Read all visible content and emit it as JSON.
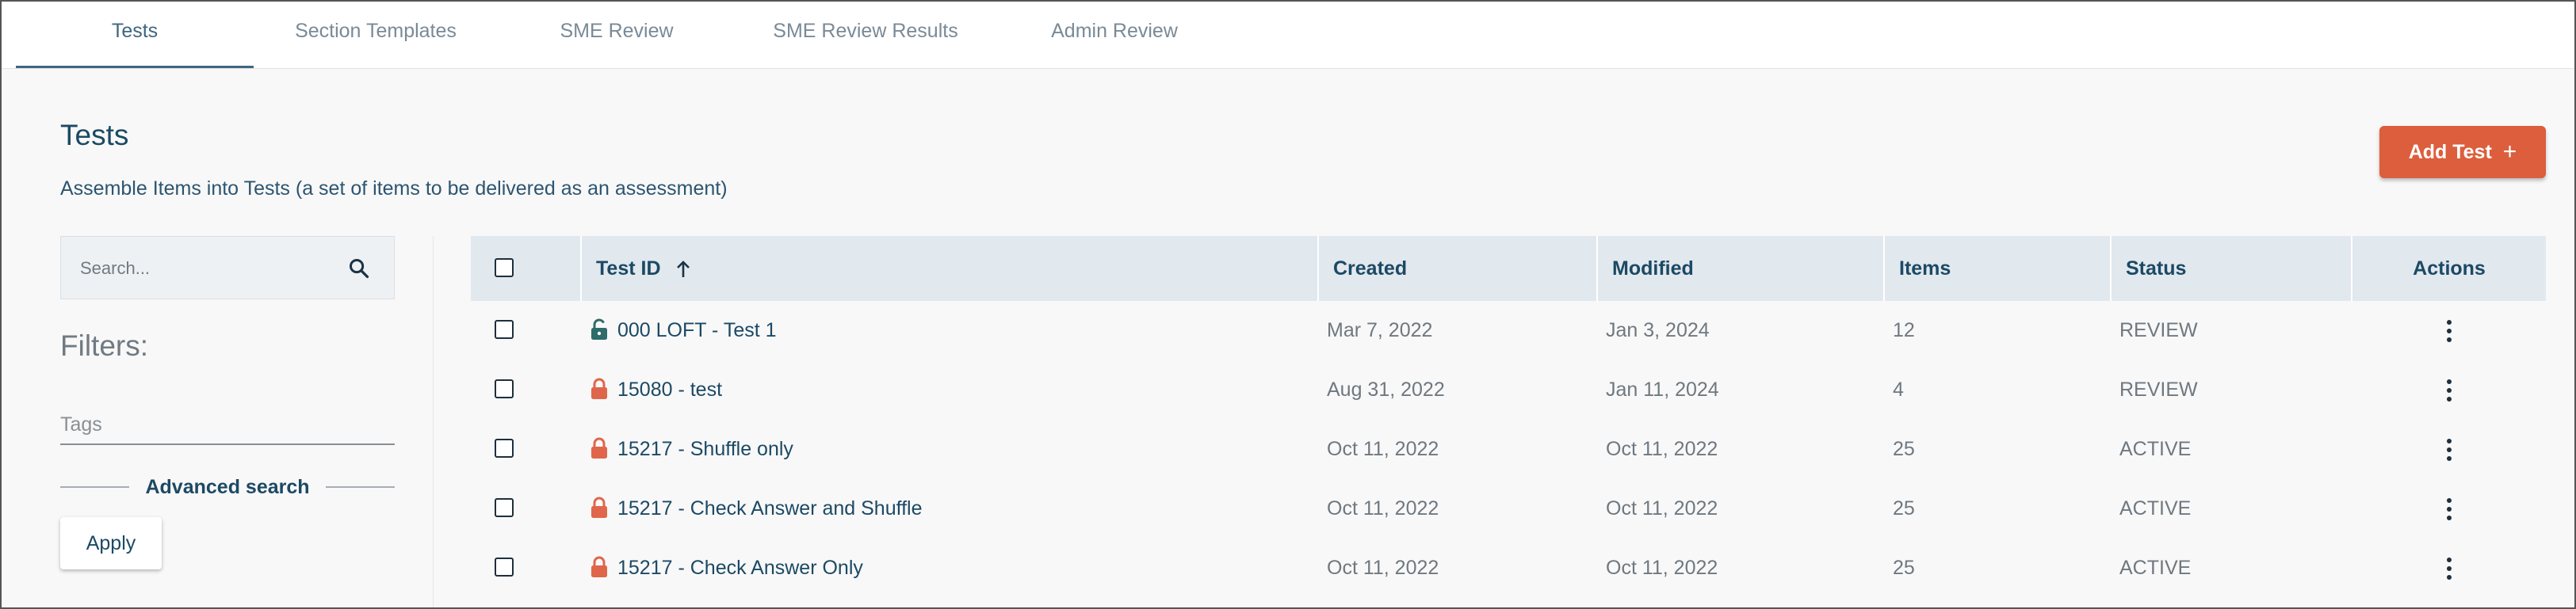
{
  "tabs": [
    {
      "label": "Tests",
      "active": true
    },
    {
      "label": "Section Templates",
      "active": false
    },
    {
      "label": "SME Review",
      "active": false
    },
    {
      "label": "SME Review Results",
      "active": false
    },
    {
      "label": "Admin Review",
      "active": false
    }
  ],
  "page": {
    "title": "Tests",
    "description": "Assemble Items into Tests (a set of items to be delivered as an assessment)",
    "add_button": "Add Test"
  },
  "filters": {
    "search_placeholder": "Search...",
    "title": "Filters:",
    "tags_placeholder": "Tags",
    "advanced_search": "Advanced search",
    "apply": "Apply"
  },
  "table": {
    "headers": {
      "test_id": "Test ID",
      "created": "Created",
      "modified": "Modified",
      "items": "Items",
      "status": "Status",
      "actions": "Actions"
    },
    "sort": {
      "column": "test_id",
      "direction": "ascending"
    },
    "rows": [
      {
        "locked": false,
        "test_id": "000 LOFT - Test 1",
        "created": "Mar 7, 2022",
        "modified": "Jan 3, 2024",
        "items": "12",
        "status": "REVIEW"
      },
      {
        "locked": true,
        "test_id": "15080 - test",
        "created": "Aug 31, 2022",
        "modified": "Jan 11, 2024",
        "items": "4",
        "status": "REVIEW"
      },
      {
        "locked": true,
        "test_id": "15217 - Shuffle only",
        "created": "Oct 11, 2022",
        "modified": "Oct 11, 2022",
        "items": "25",
        "status": "ACTIVE"
      },
      {
        "locked": true,
        "test_id": "15217 - Check Answer and Shuffle",
        "created": "Oct 11, 2022",
        "modified": "Oct 11, 2022",
        "items": "25",
        "status": "ACTIVE"
      },
      {
        "locked": true,
        "test_id": "15217 - Check Answer Only",
        "created": "Oct 11, 2022",
        "modified": "Oct 11, 2022",
        "items": "25",
        "status": "ACTIVE"
      }
    ]
  },
  "colors": {
    "accent": "#3f6680",
    "primary_button": "#dc5e3c",
    "lock_open": "#2e6b6b",
    "lock_closed": "#e0664b",
    "table_header_bg": "#e1e8ee"
  },
  "icons": {
    "search": "search-icon",
    "sort": "arrow-up-icon",
    "locked": "lock-closed-icon",
    "unlocked": "lock-open-icon",
    "actions": "more-vertical-icon",
    "add": "plus-icon"
  }
}
